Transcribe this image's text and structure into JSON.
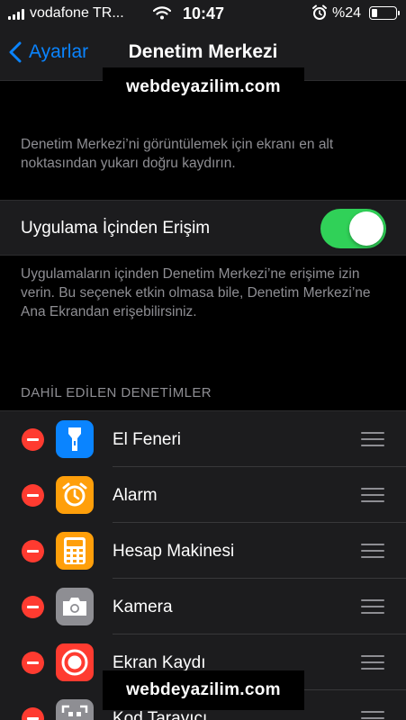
{
  "status_bar": {
    "carrier": "vodafone TR...",
    "time": "10:47",
    "battery_percent": "%24",
    "battery_level": 0.24,
    "signal_bars": 4,
    "icons": [
      "signal-icon",
      "wifi-icon",
      "alarm-clock-icon",
      "battery-icon"
    ]
  },
  "nav": {
    "back_label": "Ayarlar",
    "title": "Denetim Merkezi"
  },
  "watermark": "webdeyazilim.com",
  "description_top": "Denetim Merkezi’ni görüntülemek için ekranı en alt noktasından yukarı doğru kaydırın.",
  "toggle": {
    "label": "Uygulama İçinden Erişim",
    "on": true
  },
  "description_toggle": "Uygulamaların içinden Denetim Merkezi’ne erişime izin verin. Bu seçenek etkin olmasa bile, Denetim Merkezi’ne Ana Ekrandan erişebilirsiniz.",
  "section_header": "DAHİL EDİLEN DENETİMLER",
  "controls": [
    {
      "label": "El Feneri",
      "icon": "flashlight-icon",
      "color": "#0a84ff"
    },
    {
      "label": "Alarm",
      "icon": "alarm-clock-icon",
      "color": "#ff9f0a"
    },
    {
      "label": "Hesap Makinesi",
      "icon": "calculator-icon",
      "color": "#ff9f0a"
    },
    {
      "label": "Kamera",
      "icon": "camera-icon",
      "color": "#8e8e93"
    },
    {
      "label": "Ekran Kaydı",
      "icon": "screen-record-icon",
      "color": "#ff3b30"
    },
    {
      "label": "Kod Tarayıcı",
      "icon": "qr-scanner-icon",
      "color": "#8e8e93"
    }
  ],
  "colors": {
    "accent": "#0a84ff",
    "toggle_on": "#30d158",
    "remove": "#ff3b30",
    "background": "#000000",
    "cell": "#1c1c1e"
  }
}
